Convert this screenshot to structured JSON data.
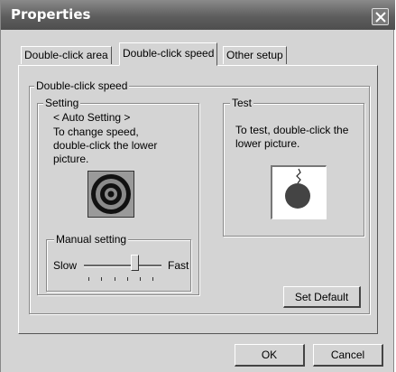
{
  "window": {
    "title": "Properties",
    "close_icon": "close-icon"
  },
  "tabs": [
    {
      "label": "Double-click area",
      "active": false
    },
    {
      "label": "Double-click speed",
      "active": true
    },
    {
      "label": "Other setup",
      "active": false
    }
  ],
  "speed_group": {
    "legend": "Double-click speed",
    "setting": {
      "legend": "Setting",
      "mode": "< Auto Setting >",
      "instructions": [
        "To change speed,",
        "double-click the lower",
        "picture."
      ],
      "picture_icon": "concentric-circles-icon",
      "manual": {
        "legend": "Manual setting",
        "slow_label": "Slow",
        "fast_label": "Fast",
        "slider_position": 0.68,
        "tick_count": 6
      }
    },
    "test": {
      "legend": "Test",
      "instructions": [
        "To test, double-click the",
        "lower picture."
      ],
      "picture_icon": "pendulum-ball-icon"
    },
    "set_default_label": "Set Default"
  },
  "buttons": {
    "ok": "OK",
    "cancel": "Cancel"
  }
}
